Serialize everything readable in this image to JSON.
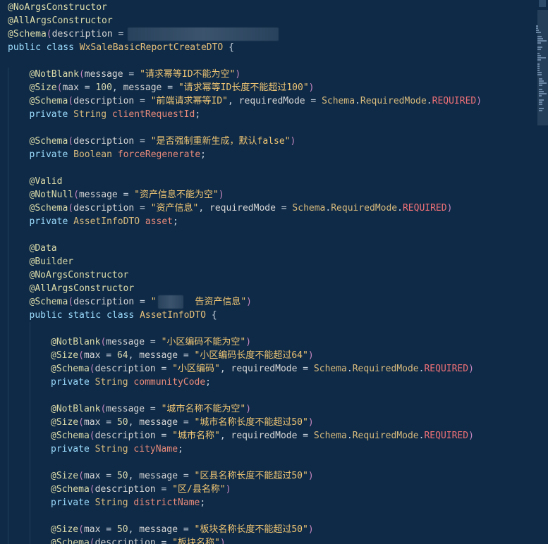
{
  "lines": [
    {
      "indent": 0,
      "segs": [
        [
          "ann",
          "@NoArgsConstructor"
        ]
      ]
    },
    {
      "indent": 0,
      "segs": [
        [
          "ann",
          "@AllArgsConstructor"
        ]
      ]
    },
    {
      "indent": 0,
      "segs": [
        [
          "ann",
          "@Schema"
        ],
        [
          "paren",
          "("
        ],
        [
          "param",
          "description"
        ],
        [
          "punct",
          " = "
        ]
      ],
      "blur": true
    },
    {
      "indent": 0,
      "segs": [
        [
          "kw",
          "public "
        ],
        [
          "kw",
          "class "
        ],
        [
          "class",
          "WxSaleBasicReportCreateDTO "
        ],
        [
          "punct",
          "{"
        ]
      ]
    },
    {
      "indent": 0,
      "segs": []
    },
    {
      "indent": 1,
      "segs": [
        [
          "ann",
          "@NotBlank"
        ],
        [
          "paren",
          "("
        ],
        [
          "param",
          "message"
        ],
        [
          "punct",
          " = "
        ],
        [
          "str",
          "\"请求幂等ID不能为空\""
        ],
        [
          "paren",
          ")"
        ]
      ]
    },
    {
      "indent": 1,
      "segs": [
        [
          "ann",
          "@Size"
        ],
        [
          "paren",
          "("
        ],
        [
          "param",
          "max"
        ],
        [
          "punct",
          " = "
        ],
        [
          "num",
          "100"
        ],
        [
          "punct",
          ", "
        ],
        [
          "param",
          "message"
        ],
        [
          "punct",
          " = "
        ],
        [
          "str",
          "\"请求幂等ID长度不能超过100\""
        ],
        [
          "paren",
          ")"
        ]
      ]
    },
    {
      "indent": 1,
      "segs": [
        [
          "ann",
          "@Schema"
        ],
        [
          "paren",
          "("
        ],
        [
          "param",
          "description"
        ],
        [
          "punct",
          " = "
        ],
        [
          "str",
          "\"前端请求幂等ID\""
        ],
        [
          "punct",
          ", "
        ],
        [
          "param",
          "requiredMode"
        ],
        [
          "punct",
          " = "
        ],
        [
          "type",
          "Schema"
        ],
        [
          "punct",
          "."
        ],
        [
          "type",
          "RequiredMode"
        ],
        [
          "punct",
          "."
        ],
        [
          "const",
          "REQUIRED"
        ],
        [
          "paren",
          ")"
        ]
      ]
    },
    {
      "indent": 1,
      "segs": [
        [
          "kw",
          "private "
        ],
        [
          "type",
          "String "
        ],
        [
          "field",
          "clientRequestId"
        ],
        [
          "punct",
          ";"
        ]
      ]
    },
    {
      "indent": 1,
      "segs": []
    },
    {
      "indent": 1,
      "segs": [
        [
          "ann",
          "@Schema"
        ],
        [
          "paren",
          "("
        ],
        [
          "param",
          "description"
        ],
        [
          "punct",
          " = "
        ],
        [
          "str",
          "\"是否强制重新生成，默认false\""
        ],
        [
          "paren",
          ")"
        ]
      ]
    },
    {
      "indent": 1,
      "segs": [
        [
          "kw",
          "private "
        ],
        [
          "type",
          "Boolean "
        ],
        [
          "field",
          "forceRegenerate"
        ],
        [
          "punct",
          ";"
        ]
      ]
    },
    {
      "indent": 1,
      "segs": []
    },
    {
      "indent": 1,
      "segs": [
        [
          "ann",
          "@Valid"
        ]
      ]
    },
    {
      "indent": 1,
      "segs": [
        [
          "ann",
          "@NotNull"
        ],
        [
          "paren",
          "("
        ],
        [
          "param",
          "message"
        ],
        [
          "punct",
          " = "
        ],
        [
          "str",
          "\"资产信息不能为空\""
        ],
        [
          "paren",
          ")"
        ]
      ]
    },
    {
      "indent": 1,
      "segs": [
        [
          "ann",
          "@Schema"
        ],
        [
          "paren",
          "("
        ],
        [
          "param",
          "description"
        ],
        [
          "punct",
          " = "
        ],
        [
          "str",
          "\"资产信息\""
        ],
        [
          "punct",
          ", "
        ],
        [
          "param",
          "requiredMode"
        ],
        [
          "punct",
          " = "
        ],
        [
          "type",
          "Schema"
        ],
        [
          "punct",
          "."
        ],
        [
          "type",
          "RequiredMode"
        ],
        [
          "punct",
          "."
        ],
        [
          "const",
          "REQUIRED"
        ],
        [
          "paren",
          ")"
        ]
      ]
    },
    {
      "indent": 1,
      "segs": [
        [
          "kw",
          "private "
        ],
        [
          "type",
          "AssetInfoDTO "
        ],
        [
          "field",
          "asset"
        ],
        [
          "punct",
          ";"
        ]
      ]
    },
    {
      "indent": 1,
      "segs": []
    },
    {
      "indent": 1,
      "segs": [
        [
          "ann",
          "@Data"
        ]
      ]
    },
    {
      "indent": 1,
      "segs": [
        [
          "ann",
          "@Builder"
        ]
      ]
    },
    {
      "indent": 1,
      "segs": [
        [
          "ann",
          "@NoArgsConstructor"
        ]
      ]
    },
    {
      "indent": 1,
      "segs": [
        [
          "ann",
          "@AllArgsConstructor"
        ]
      ]
    },
    {
      "indent": 1,
      "segs": [
        [
          "ann",
          "@Schema"
        ],
        [
          "paren",
          "("
        ],
        [
          "param",
          "description"
        ],
        [
          "punct",
          " = "
        ],
        [
          "str",
          "\"       告资产信息\""
        ],
        [
          "paren",
          ")"
        ]
      ],
      "blurInline": true
    },
    {
      "indent": 1,
      "segs": [
        [
          "kw",
          "public "
        ],
        [
          "kw",
          "static "
        ],
        [
          "kw",
          "class "
        ],
        [
          "class",
          "AssetInfoDTO "
        ],
        [
          "punct",
          "{"
        ]
      ]
    },
    {
      "indent": 2,
      "segs": []
    },
    {
      "indent": 2,
      "segs": [
        [
          "ann",
          "@NotBlank"
        ],
        [
          "paren",
          "("
        ],
        [
          "param",
          "message"
        ],
        [
          "punct",
          " = "
        ],
        [
          "str",
          "\"小区编码不能为空\""
        ],
        [
          "paren",
          ")"
        ]
      ]
    },
    {
      "indent": 2,
      "segs": [
        [
          "ann",
          "@Size"
        ],
        [
          "paren",
          "("
        ],
        [
          "param",
          "max"
        ],
        [
          "punct",
          " = "
        ],
        [
          "num",
          "64"
        ],
        [
          "punct",
          ", "
        ],
        [
          "param",
          "message"
        ],
        [
          "punct",
          " = "
        ],
        [
          "str",
          "\"小区编码长度不能超过64\""
        ],
        [
          "paren",
          ")"
        ]
      ]
    },
    {
      "indent": 2,
      "segs": [
        [
          "ann",
          "@Schema"
        ],
        [
          "paren",
          "("
        ],
        [
          "param",
          "description"
        ],
        [
          "punct",
          " = "
        ],
        [
          "str",
          "\"小区编码\""
        ],
        [
          "punct",
          ", "
        ],
        [
          "param",
          "requiredMode"
        ],
        [
          "punct",
          " = "
        ],
        [
          "type",
          "Schema"
        ],
        [
          "punct",
          "."
        ],
        [
          "type",
          "RequiredMode"
        ],
        [
          "punct",
          "."
        ],
        [
          "const",
          "REQUIRED"
        ],
        [
          "paren",
          ")"
        ]
      ]
    },
    {
      "indent": 2,
      "segs": [
        [
          "kw",
          "private "
        ],
        [
          "type",
          "String "
        ],
        [
          "field",
          "communityCode"
        ],
        [
          "punct",
          ";"
        ]
      ]
    },
    {
      "indent": 2,
      "segs": []
    },
    {
      "indent": 2,
      "segs": [
        [
          "ann",
          "@NotBlank"
        ],
        [
          "paren",
          "("
        ],
        [
          "param",
          "message"
        ],
        [
          "punct",
          " = "
        ],
        [
          "str",
          "\"城市名称不能为空\""
        ],
        [
          "paren",
          ")"
        ]
      ]
    },
    {
      "indent": 2,
      "segs": [
        [
          "ann",
          "@Size"
        ],
        [
          "paren",
          "("
        ],
        [
          "param",
          "max"
        ],
        [
          "punct",
          " = "
        ],
        [
          "num",
          "50"
        ],
        [
          "punct",
          ", "
        ],
        [
          "param",
          "message"
        ],
        [
          "punct",
          " = "
        ],
        [
          "str",
          "\"城市名称长度不能超过50\""
        ],
        [
          "paren",
          ")"
        ]
      ]
    },
    {
      "indent": 2,
      "segs": [
        [
          "ann",
          "@Schema"
        ],
        [
          "paren",
          "("
        ],
        [
          "param",
          "description"
        ],
        [
          "punct",
          " = "
        ],
        [
          "str",
          "\"城市名称\""
        ],
        [
          "punct",
          ", "
        ],
        [
          "param",
          "requiredMode"
        ],
        [
          "punct",
          " = "
        ],
        [
          "type",
          "Schema"
        ],
        [
          "punct",
          "."
        ],
        [
          "type",
          "RequiredMode"
        ],
        [
          "punct",
          "."
        ],
        [
          "const",
          "REQUIRED"
        ],
        [
          "paren",
          ")"
        ]
      ]
    },
    {
      "indent": 2,
      "segs": [
        [
          "kw",
          "private "
        ],
        [
          "type",
          "String "
        ],
        [
          "field",
          "cityName"
        ],
        [
          "punct",
          ";"
        ]
      ]
    },
    {
      "indent": 2,
      "segs": []
    },
    {
      "indent": 2,
      "segs": [
        [
          "ann",
          "@Size"
        ],
        [
          "paren",
          "("
        ],
        [
          "param",
          "max"
        ],
        [
          "punct",
          " = "
        ],
        [
          "num",
          "50"
        ],
        [
          "punct",
          ", "
        ],
        [
          "param",
          "message"
        ],
        [
          "punct",
          " = "
        ],
        [
          "str",
          "\"区县名称长度不能超过50\""
        ],
        [
          "paren",
          ")"
        ]
      ]
    },
    {
      "indent": 2,
      "segs": [
        [
          "ann",
          "@Schema"
        ],
        [
          "paren",
          "("
        ],
        [
          "param",
          "description"
        ],
        [
          "punct",
          " = "
        ],
        [
          "str",
          "\"区/县名称\""
        ],
        [
          "paren",
          ")"
        ]
      ]
    },
    {
      "indent": 2,
      "segs": [
        [
          "kw",
          "private "
        ],
        [
          "type",
          "String "
        ],
        [
          "field",
          "districtName"
        ],
        [
          "punct",
          ";"
        ]
      ]
    },
    {
      "indent": 2,
      "segs": []
    },
    {
      "indent": 2,
      "segs": [
        [
          "ann",
          "@Size"
        ],
        [
          "paren",
          "("
        ],
        [
          "param",
          "max"
        ],
        [
          "punct",
          " = "
        ],
        [
          "num",
          "50"
        ],
        [
          "punct",
          ", "
        ],
        [
          "param",
          "message"
        ],
        [
          "punct",
          " = "
        ],
        [
          "str",
          "\"板块名称长度不能超过50\""
        ],
        [
          "paren",
          ")"
        ]
      ]
    },
    {
      "indent": 2,
      "segs": [
        [
          "ann",
          "@Schema"
        ],
        [
          "paren",
          "("
        ],
        [
          "param",
          "description"
        ],
        [
          "punct",
          " = "
        ],
        [
          "str",
          "\"板块名称\""
        ],
        [
          "paren",
          ")"
        ]
      ]
    }
  ],
  "colors": {
    "background": "#0f2a46",
    "annotation": "#dcdcaa",
    "string": "#f0c674",
    "keyword": "#9cdcfe",
    "constant": "#f07178",
    "field": "#e88a7a"
  },
  "icons": {
    "minimap": "minimap-icon"
  }
}
